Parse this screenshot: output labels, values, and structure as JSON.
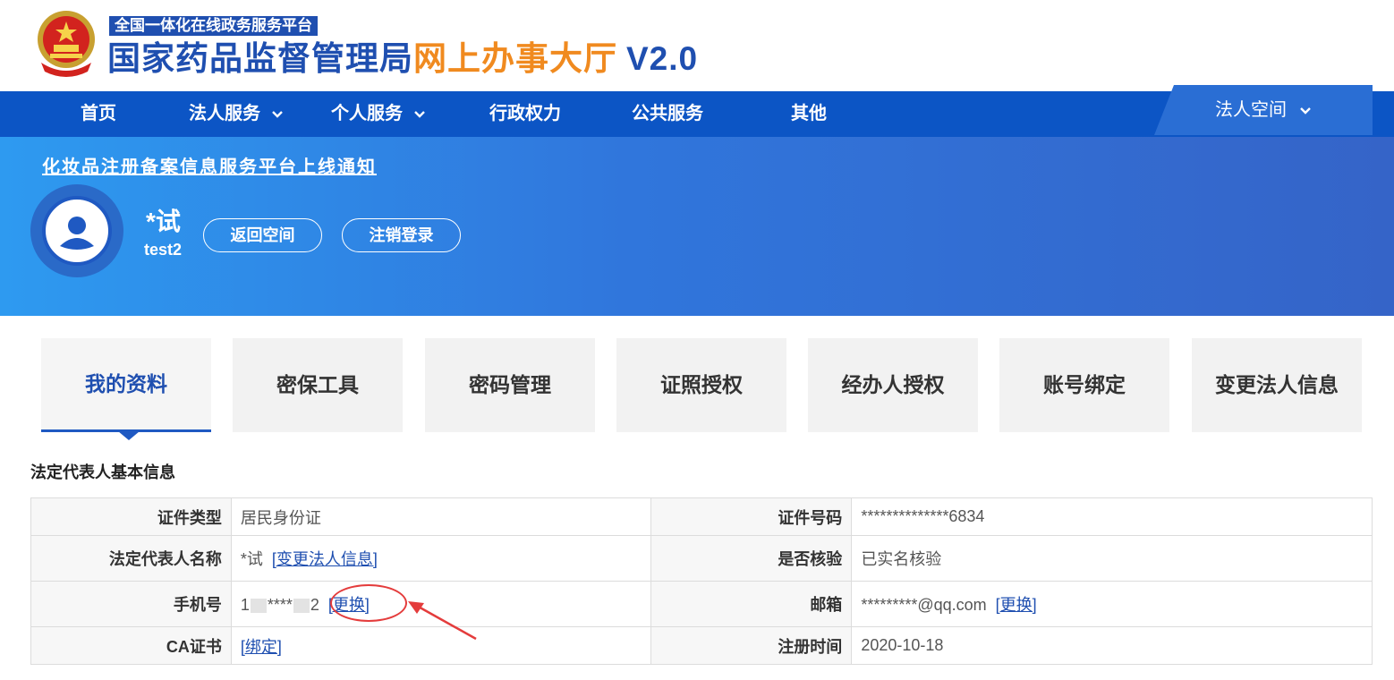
{
  "header": {
    "platform_badge": "全国一体化在线政务服务平台",
    "title_blue": "国家药品监督管理局",
    "title_orange": "网上办事大厅",
    "version": "V2.0"
  },
  "nav": {
    "items": [
      {
        "label": "首页",
        "has_dropdown": false
      },
      {
        "label": "法人服务",
        "has_dropdown": true
      },
      {
        "label": "个人服务",
        "has_dropdown": true
      },
      {
        "label": "行政权力",
        "has_dropdown": false
      },
      {
        "label": "公共服务",
        "has_dropdown": false
      },
      {
        "label": "其他",
        "has_dropdown": false
      }
    ],
    "space_label": "法人空间"
  },
  "banner": {
    "notice": "化妆品注册备案信息服务平台上线通知",
    "user_name": "*试",
    "user_id": "test2",
    "back_button": "返回空间",
    "logout_button": "注销登录"
  },
  "tabs": [
    {
      "label": "我的资料",
      "active": true
    },
    {
      "label": "密保工具",
      "active": false
    },
    {
      "label": "密码管理",
      "active": false
    },
    {
      "label": "证照授权",
      "active": false
    },
    {
      "label": "经办人授权",
      "active": false
    },
    {
      "label": "账号绑定",
      "active": false
    },
    {
      "label": "变更法人信息",
      "active": false
    }
  ],
  "section_title": "法定代表人基本信息",
  "info": {
    "id_type_label": "证件类型",
    "id_type_value": "居民身份证",
    "id_number_label": "证件号码",
    "id_number_value": "**************6834",
    "rep_name_label": "法定代表人名称",
    "rep_name_value": "*试",
    "rep_name_link": "[变更法人信息]",
    "verified_label": "是否核验",
    "verified_value": "已实名核验",
    "phone_label": "手机号",
    "phone_prefix": "1",
    "phone_stars": "****",
    "phone_suffix": "2",
    "phone_link": "[更换]",
    "email_label": "邮箱",
    "email_value": "*********@qq.com",
    "email_link": "[更换]",
    "ca_label": "CA证书",
    "ca_link": "[绑定]",
    "reg_time_label": "注册时间",
    "reg_time_value": "2020-10-18"
  },
  "colors": {
    "brand_blue": "#1f4fb0",
    "nav_blue": "#0c55c5",
    "accent_orange": "#f08a1f",
    "callout_red": "#e43c3c"
  }
}
